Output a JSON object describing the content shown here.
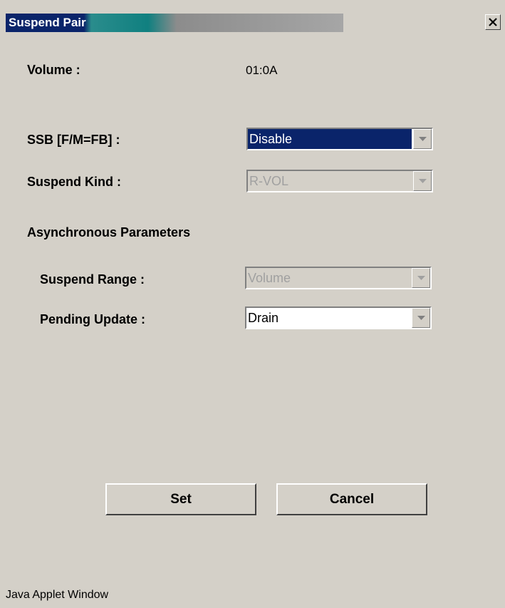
{
  "window": {
    "title": "Suspend Pair",
    "close_icon": "close-icon"
  },
  "volume": {
    "label": "Volume :",
    "value": "01:0A"
  },
  "ssb": {
    "label": "SSB [F/M=FB] :",
    "selected": "Disable"
  },
  "suspend_kind": {
    "label": "Suspend Kind :",
    "selected": "R-VOL"
  },
  "async_section": {
    "heading": "Asynchronous Parameters"
  },
  "suspend_range": {
    "label": "Suspend Range :",
    "selected": "Volume"
  },
  "pending_update": {
    "label": "Pending Update :",
    "selected": "Drain"
  },
  "buttons": {
    "set_label": "Set",
    "cancel_label": "Cancel"
  },
  "status_bar": {
    "text": "Java Applet Window"
  },
  "colors": {
    "title_active": "#0a246a",
    "face": "#d4d0c8",
    "selection": "#0a246a",
    "disabled_text": "#a0a0a0"
  }
}
